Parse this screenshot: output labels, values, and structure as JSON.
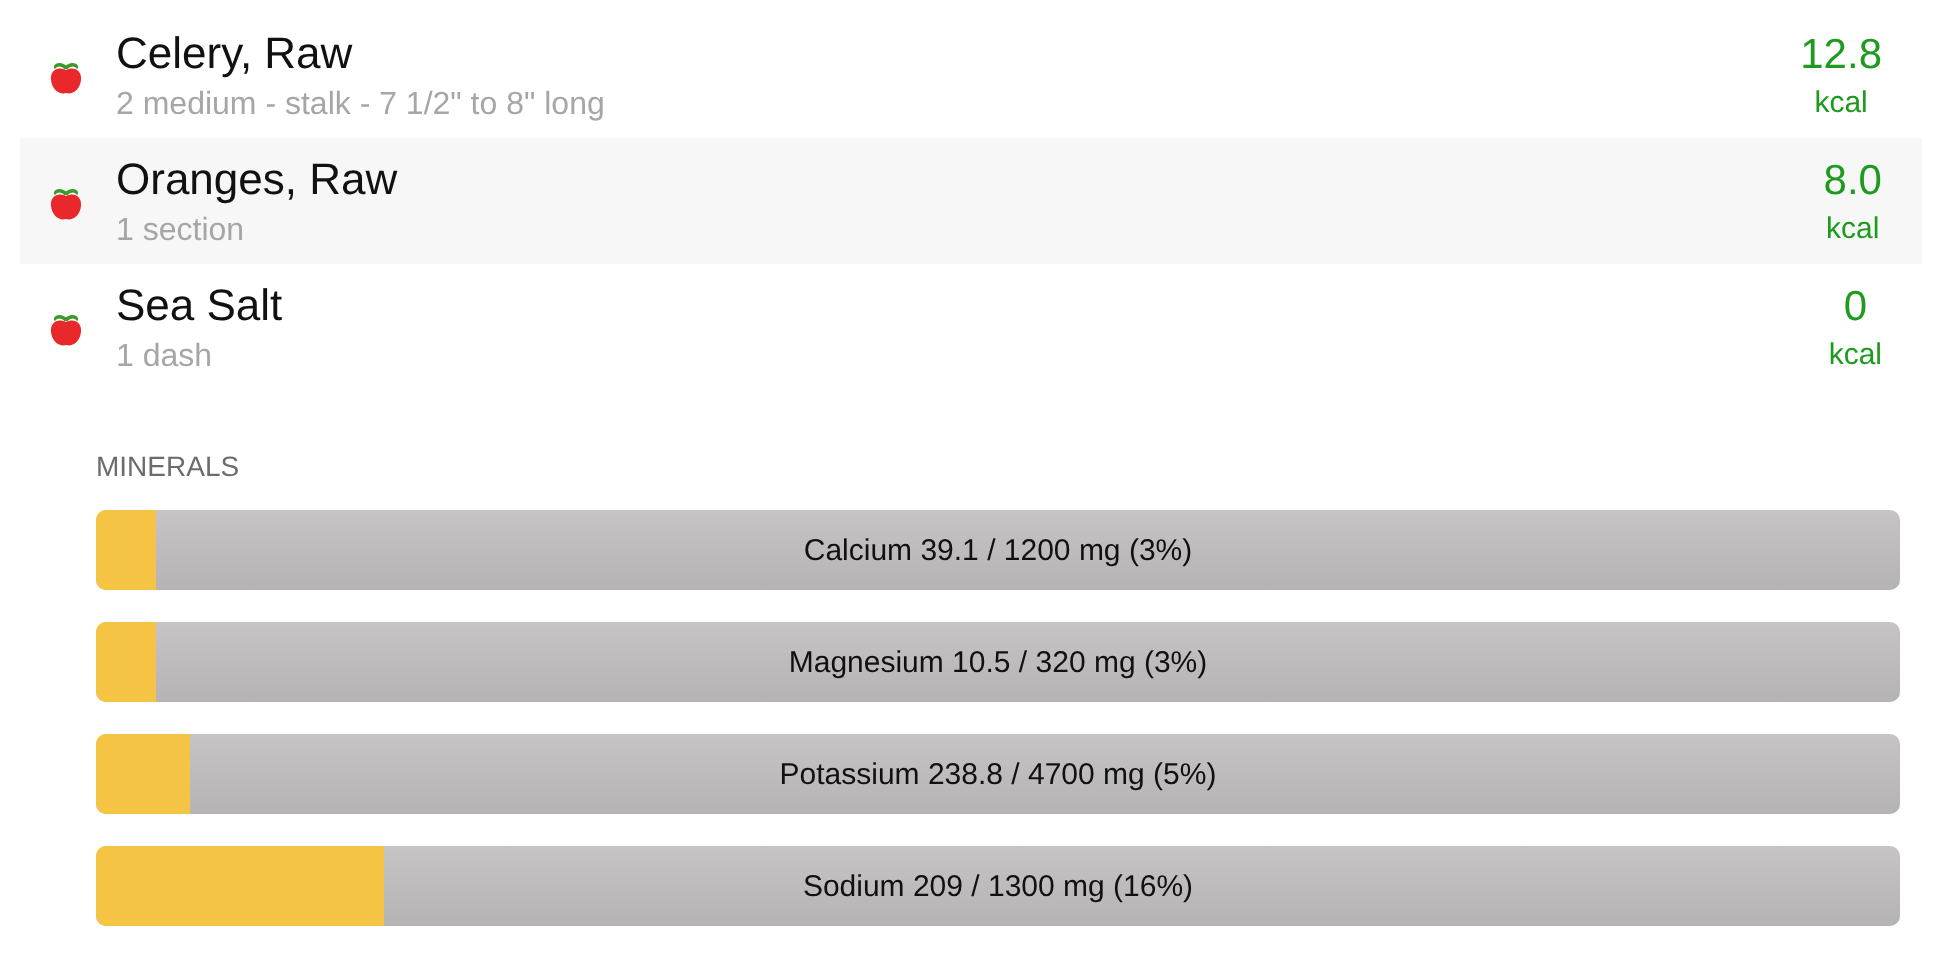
{
  "foods": [
    {
      "name": "Celery, Raw",
      "serving": "2 medium - stalk - 7 1/2\" to 8\" long",
      "calories": "12.8",
      "unit": "kcal"
    },
    {
      "name": "Oranges, Raw",
      "serving": "1 section",
      "calories": "8.0",
      "unit": "kcal"
    },
    {
      "name": "Sea Salt",
      "serving": "1 dash",
      "calories": "0",
      "unit": "kcal"
    }
  ],
  "minerals": {
    "heading": "MINERALS",
    "bars": [
      {
        "label": "Calcium 39.1 / 1200 mg (3%)",
        "level": 0.033
      },
      {
        "label": "Magnesium 10.5 / 320 mg (3%)",
        "level": 0.033
      },
      {
        "label": "Potassium 238.8 / 4700 mg (5%)",
        "level": 0.052
      },
      {
        "label": "Sodium 209 / 1300 mg (16%)",
        "level": 0.16
      }
    ]
  }
}
